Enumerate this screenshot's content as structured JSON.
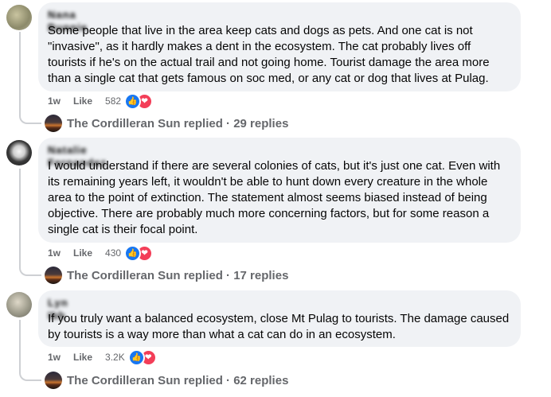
{
  "comments": [
    {
      "author": "Nana Bunnie",
      "text": "Some people that live in the area keep cats and dogs as pets. And one cat is not \"invasive\", as it hardly makes a dent in the ecosystem. The cat probably lives off tourists if he's on the actual trail and not going home. Tourist damage the area more than a single cat that gets famous on soc med, or any cat or dog that lives at Pulag.",
      "time": "1w",
      "like_label": "Like",
      "reaction_count": "582",
      "reply_author": "The Cordilleran Sun",
      "reply_text": "replied · 29 replies"
    },
    {
      "author": "Natalie Fernandez",
      "text": "I would understand if there are several colonies of cats, but it's just one cat. Even with its remaining years left, it wouldn't be able to hunt down every creature in the whole area to the point of extinction. The statement almost seems biased instead of being objective. There are probably much more concerning factors, but for some reason a single cat is their focal point.",
      "time": "1w",
      "like_label": "Like",
      "reaction_count": "430",
      "reply_author": "The Cordilleran Sun",
      "reply_text": "replied · 17 replies"
    },
    {
      "author": "Lyn Ibb",
      "text": "If you truly want a balanced ecosystem, close Mt Pulag to tourists. The damage caused by tourists is a way more than what a cat can do in an ecosystem.",
      "time": "1w",
      "like_label": "Like",
      "reaction_count": "3.2K",
      "reply_author": "The Cordilleran Sun",
      "reply_text": "replied · 62 replies"
    }
  ],
  "icons": {
    "like": "thumbs-up-icon",
    "love": "heart-icon"
  },
  "colors": {
    "bubble": "#f0f2f5",
    "like_blue": "#1877f2",
    "love_red": "#f33e58",
    "meta_grey": "#65676b"
  }
}
